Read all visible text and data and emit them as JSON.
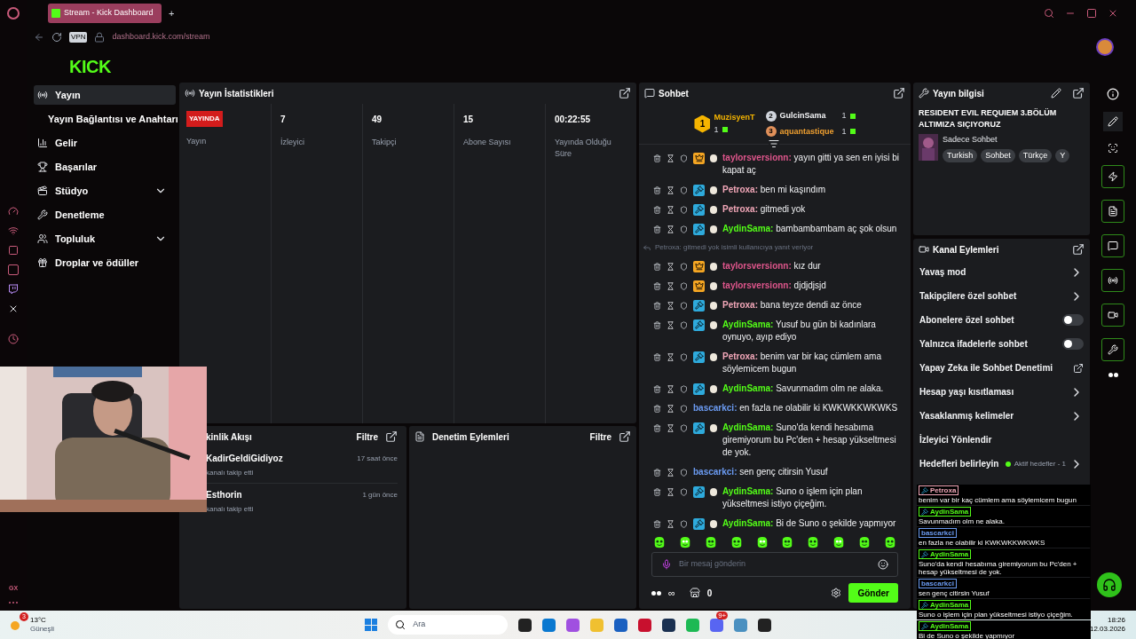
{
  "browser": {
    "tab": "Stream - Kick Dashboard",
    "new_tab": "+",
    "url": "dashboard.kick.com/stream",
    "vpn": "VPN"
  },
  "logo": "KICK",
  "nav": [
    {
      "label": "Yayın",
      "selected": true,
      "expandable": false,
      "sub": false
    },
    {
      "label": "Yayın Bağlantısı ve Anahtarı",
      "selected": false,
      "expandable": false,
      "sub": true
    },
    {
      "label": "Gelir",
      "selected": false,
      "expandable": false,
      "sub": false
    },
    {
      "label": "Başarılar",
      "selected": false,
      "expandable": false,
      "sub": false
    },
    {
      "label": "Stüdyo",
      "selected": false,
      "expandable": true,
      "sub": false
    },
    {
      "label": "Denetleme",
      "selected": false,
      "expandable": false,
      "sub": false
    },
    {
      "label": "Topluluk",
      "selected": false,
      "expandable": true,
      "sub": false
    },
    {
      "label": "Droplar ve ödüller",
      "selected": false,
      "expandable": false,
      "sub": false
    }
  ],
  "opera_sidebar": {
    "bottom_label": "GX"
  },
  "stats": {
    "title": "Yayın İstatistikleri",
    "badge": "YAYINDA",
    "badge_label": "Yayın",
    "items": [
      {
        "value": "7",
        "label": "İzleyici"
      },
      {
        "value": "49",
        "label": "Takipçi"
      },
      {
        "value": "15",
        "label": "Abone Sayısı"
      },
      {
        "value": "00:22:55",
        "label": "Yayında Olduğu Süre"
      }
    ]
  },
  "activity": {
    "title": "kinlik Akışı",
    "filter": "Filtre",
    "events": [
      {
        "user": "KadirGeldiGidiyoz",
        "action": "kanalı takip etti",
        "time": "17 saat önce"
      },
      {
        "user": "Esthorin",
        "action": "kanalı takip etti",
        "time": "1 gün önce"
      }
    ]
  },
  "mod_actions": {
    "title": "Denetim Eylemleri",
    "filter": "Filtre"
  },
  "chat": {
    "title": "Sohbet",
    "leaders": [
      {
        "rank": "1",
        "name": "MuzisyenT",
        "count": "1"
      },
      {
        "rank": "2",
        "name": "GulcinSama",
        "count": "1"
      },
      {
        "rank": "3",
        "name": "aquantastique",
        "count": "1"
      }
    ],
    "messages": [
      {
        "kind": "vip",
        "user": "taylorsversionn:",
        "color": "#e0568c",
        "text": "yayın gitti ya sen en iyisi bi kapat aç"
      },
      {
        "kind": "mod",
        "user": "Petroxa:",
        "color": "#f2a7b8",
        "text": "ben mi kaşındım"
      },
      {
        "kind": "mod",
        "user": "Petroxa:",
        "color": "#f2a7b8",
        "text": "gitmedi yok"
      },
      {
        "kind": "mod",
        "user": "AydinSama:",
        "color": "#53fc18",
        "text": "bambambambam aç şok olsun"
      },
      {
        "kind": "reply",
        "text": "Petroxa: gitmedi yok isimli kullanıcıya yanıt veriyor"
      },
      {
        "kind": "vip",
        "user": "taylorsversionn:",
        "color": "#e0568c",
        "text": "kız dur"
      },
      {
        "kind": "vip",
        "user": "taylorsversionn:",
        "color": "#e0568c",
        "text": "djdjdjsjd"
      },
      {
        "kind": "mod",
        "user": "Petroxa:",
        "color": "#f2a7b8",
        "text": "bana teyze dendi az önce"
      },
      {
        "kind": "mod",
        "user": "AydinSama:",
        "color": "#53fc18",
        "text": "Yusuf bu gün bi kadınlara oynuyo, ayıp ediyo"
      },
      {
        "kind": "mod",
        "user": "Petroxa:",
        "color": "#f2a7b8",
        "text": "benim var bir kaç cümlem ama söylemicem bugun"
      },
      {
        "kind": "mod",
        "user": "AydinSama:",
        "color": "#53fc18",
        "text": "Savunmadım olm ne alaka."
      },
      {
        "kind": "plain",
        "user": "bascarkci:",
        "color": "#6b9bf2",
        "text": "en fazla ne olabilir ki KWKWKKWKWKS"
      },
      {
        "kind": "mod",
        "user": "AydinSama:",
        "color": "#53fc18",
        "text": "Suno'da kendi hesabıma giremiyorum bu Pc'den + hesap yükseltmesi de yok."
      },
      {
        "kind": "plain",
        "user": "bascarkci:",
        "color": "#6b9bf2",
        "text": "sen genç citirsin Yusuf"
      },
      {
        "kind": "mod",
        "user": "AydinSama:",
        "color": "#53fc18",
        "text": "Suno o işlem için plan yükseltmesi istiyo çiçeğim."
      },
      {
        "kind": "mod",
        "user": "AydinSama:",
        "color": "#53fc18",
        "text": "Bi de Suno o şekilde yapmıyor"
      }
    ],
    "placeholder": "Bir mesaj gönderin",
    "infinity": "∞",
    "points": "0",
    "send": "Gönder"
  },
  "stream_info": {
    "title": "Yayın bilgisi",
    "stream_title": "RESIDENT EVIL REQUIEM 3.BÖLÜM ALTIMIZA SIÇIYORUZ",
    "category": "Sadece Sohbet",
    "tags": [
      "Turkish",
      "Sohbet",
      "Türkçe",
      "Y"
    ]
  },
  "channel_actions": {
    "title": "Kanal Eylemleri",
    "items": [
      {
        "kind": "chevron",
        "label": "Yavaş mod"
      },
      {
        "kind": "chevron",
        "label": "Takipçilere özel sohbet"
      },
      {
        "kind": "toggle",
        "label": "Abonelere özel sohbet",
        "on": false
      },
      {
        "kind": "toggle",
        "label": "Yalnızca ifadelerle sohbet",
        "on": false
      },
      {
        "kind": "external",
        "label": "Yapay Zeka ile Sohbet Denetimi"
      },
      {
        "kind": "chevron",
        "label": "Hesap yaşı kısıtlaması"
      },
      {
        "kind": "chevron",
        "label": "Yasaklanmış kelimeler"
      },
      {
        "kind": "plain",
        "label": "İzleyici Yönlendir"
      },
      {
        "kind": "goals",
        "label": "Hedefleri belirleyin",
        "status": "Aktif hedefler - 1",
        "color": "#53fc18"
      }
    ]
  },
  "overlay_chat": [
    {
      "user": "Petroxa",
      "color": "#f2a7b8",
      "mod": true,
      "text": "benim var bir kaç cümlem ama söylemicem bugun"
    },
    {
      "user": "AydinSama",
      "color": "#53fc18",
      "mod": true,
      "text": "Savunmadım olm ne alaka."
    },
    {
      "user": "bascarkci",
      "color": "#6b9bf2",
      "mod": false,
      "text": "en fazla ne olabilir ki KWKWKKWKWKS"
    },
    {
      "user": "AydinSama",
      "color": "#53fc18",
      "mod": true,
      "text": "Suno'da kendi hesabıma giremiyorum bu Pc'den + hesap yükseltmesi de yok."
    },
    {
      "user": "bascarkci",
      "color": "#6b9bf2",
      "mod": false,
      "text": "sen genç citirsin Yusuf"
    },
    {
      "user": "AydinSama",
      "color": "#53fc18",
      "mod": true,
      "text": "Suno o işlem için plan yükseltmesi istiyo çiçeğim."
    },
    {
      "user": "AydinSama",
      "color": "#53fc18",
      "mod": true,
      "text": "Bi de Suno o şekilde yapmıyor"
    }
  ],
  "taskbar": {
    "weather_badge": "3",
    "temperature": "13°C",
    "condition": "Güneşli",
    "search": "Ara",
    "discord_badge": "9+",
    "time": "18:26",
    "date": "12.03.2026"
  }
}
